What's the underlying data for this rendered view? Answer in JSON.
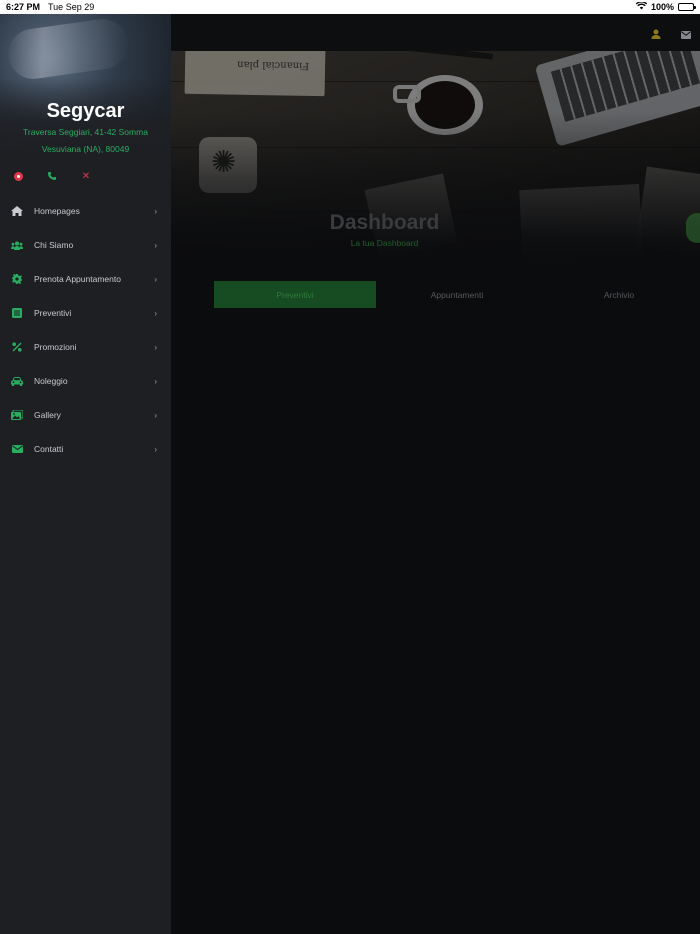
{
  "status_bar": {
    "time": "6:27 PM",
    "date": "Tue Sep 29",
    "battery": "100%"
  },
  "sidebar": {
    "title": "Segycar",
    "address_line1": "Traversa Seggiari, 41-42 Somma",
    "address_line2": "Vesuviana (NA), 80049",
    "items": [
      {
        "label": "Homepages",
        "icon": "home-icon"
      },
      {
        "label": "Chi Siamo",
        "icon": "users-icon"
      },
      {
        "label": "Prenota Appuntamento",
        "icon": "gear-icon"
      },
      {
        "label": "Preventivi",
        "icon": "document-icon"
      },
      {
        "label": "Promozioni",
        "icon": "percent-icon"
      },
      {
        "label": "Noleggio",
        "icon": "car-icon"
      },
      {
        "label": "Gallery",
        "icon": "gallery-icon"
      },
      {
        "label": "Contatti",
        "icon": "mail-icon"
      }
    ]
  },
  "hero": {
    "clipboard_text": "Financial plan"
  },
  "dashboard": {
    "title": "Dashboard",
    "subtitle": "La tua Dashboard",
    "tabs": [
      {
        "label": "Preventivi"
      },
      {
        "label": "Appuntamenti"
      },
      {
        "label": "Archivio"
      }
    ]
  },
  "colors": {
    "accent_green": "#27ae60",
    "danger_red": "#e0384b",
    "sidebar_bg": "#1e1f23",
    "main_bg": "#0b0c0e"
  }
}
